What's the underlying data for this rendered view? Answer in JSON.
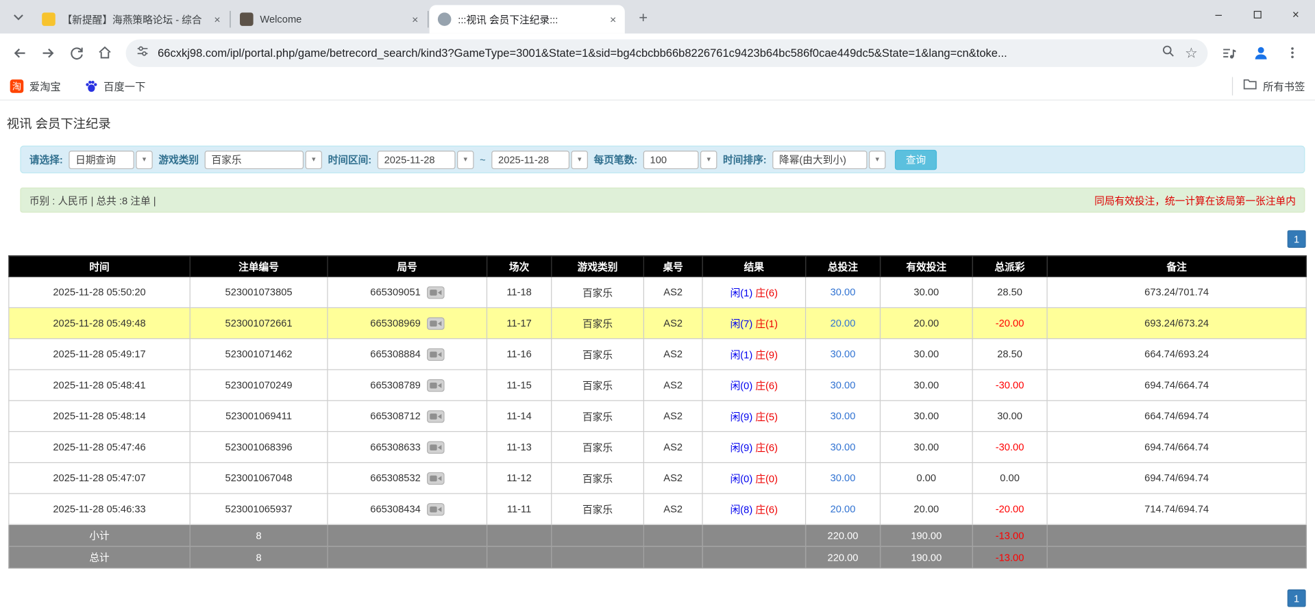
{
  "colors": {
    "accent-blue": "#337ab7",
    "link-blue": "#3173d2",
    "player-blue": "#0000ee",
    "banker-red": "#ee0000",
    "negative-red": "#ff0000",
    "notice-red": "#dd0000",
    "highlight-yellow": "#ffff99",
    "header-black": "#000000",
    "footer-gray": "#8a8a8a",
    "filter-bg": "#d9edf7",
    "filter-border": "#bce8f1",
    "filter-label": "#31708f",
    "summary-bg": "#dff0d8",
    "summary-border": "#d6e9c6",
    "search-btn": "#5bc0de"
  },
  "browser": {
    "tabs": [
      {
        "title": "【新提醒】海燕策略论坛 - 综合"
      },
      {
        "title": "Welcome"
      },
      {
        "title": ":::视讯 会员下注纪录:::"
      }
    ],
    "url": "66cxkj98.com/ipl/portal.php/game/betrecord_search/kind3?GameType=3001&State=1&sid=bg4cbcbb66b8226761c9423b64bc586f0cae449dc5&State=1&lang=cn&toke...",
    "bookmarks": [
      {
        "label": "爱淘宝"
      },
      {
        "label": "百度一下"
      }
    ],
    "all_bookmarks_label": "所有书签"
  },
  "page": {
    "title": "视讯 会员下注纪录",
    "filters": {
      "select_label": "请选择:",
      "select_value": "日期查询",
      "game_type_label": "游戏类别",
      "game_type_value": "百家乐",
      "date_range_label": "时间区间:",
      "date_from": "2025-11-28",
      "date_separator": "~",
      "date_to": "2025-11-28",
      "per_page_label": "每页笔数:",
      "per_page_value": "100",
      "sort_label": "时间排序:",
      "sort_value": "降幂(由大到小)",
      "search_button_label": "查询"
    },
    "summary_text": "币别 : 人民币 | 总共 :8 注单 |",
    "notice_text": "同局有效投注，统一计算在该局第一张注单内",
    "pagination_label": "1"
  },
  "table": {
    "headers": [
      "时间",
      "注单编号",
      "局号",
      "场次",
      "游戏类别",
      "桌号",
      "结果",
      "总投注",
      "有效投注",
      "总派彩",
      "备注"
    ],
    "rows": [
      {
        "time": "2025-11-28 05:50:20",
        "bet_id": "523001073805",
        "round_id": "665309051",
        "session": "11-18",
        "game": "百家乐",
        "table_no": "AS2",
        "result_player": "闲(1)",
        "result_banker": "庄(6)",
        "total_bet": "30.00",
        "valid_bet": "30.00",
        "payout": "28.50",
        "note": "673.24/701.74",
        "highlight": false
      },
      {
        "time": "2025-11-28 05:49:48",
        "bet_id": "523001072661",
        "round_id": "665308969",
        "session": "11-17",
        "game": "百家乐",
        "table_no": "AS2",
        "result_player": "闲(7)",
        "result_banker": "庄(1)",
        "total_bet": "20.00",
        "valid_bet": "20.00",
        "payout": "-20.00",
        "note": "693.24/673.24",
        "highlight": true
      },
      {
        "time": "2025-11-28 05:49:17",
        "bet_id": "523001071462",
        "round_id": "665308884",
        "session": "11-16",
        "game": "百家乐",
        "table_no": "AS2",
        "result_player": "闲(1)",
        "result_banker": "庄(9)",
        "total_bet": "30.00",
        "valid_bet": "30.00",
        "payout": "28.50",
        "note": "664.74/693.24",
        "highlight": false
      },
      {
        "time": "2025-11-28 05:48:41",
        "bet_id": "523001070249",
        "round_id": "665308789",
        "session": "11-15",
        "game": "百家乐",
        "table_no": "AS2",
        "result_player": "闲(0)",
        "result_banker": "庄(6)",
        "total_bet": "30.00",
        "valid_bet": "30.00",
        "payout": "-30.00",
        "note": "694.74/664.74",
        "highlight": false
      },
      {
        "time": "2025-11-28 05:48:14",
        "bet_id": "523001069411",
        "round_id": "665308712",
        "session": "11-14",
        "game": "百家乐",
        "table_no": "AS2",
        "result_player": "闲(9)",
        "result_banker": "庄(5)",
        "total_bet": "30.00",
        "valid_bet": "30.00",
        "payout": "30.00",
        "note": "664.74/694.74",
        "highlight": false
      },
      {
        "time": "2025-11-28 05:47:46",
        "bet_id": "523001068396",
        "round_id": "665308633",
        "session": "11-13",
        "game": "百家乐",
        "table_no": "AS2",
        "result_player": "闲(9)",
        "result_banker": "庄(6)",
        "total_bet": "30.00",
        "valid_bet": "30.00",
        "payout": "-30.00",
        "note": "694.74/664.74",
        "highlight": false
      },
      {
        "time": "2025-11-28 05:47:07",
        "bet_id": "523001067048",
        "round_id": "665308532",
        "session": "11-12",
        "game": "百家乐",
        "table_no": "AS2",
        "result_player": "闲(0)",
        "result_banker": "庄(0)",
        "total_bet": "30.00",
        "valid_bet": "0.00",
        "payout": "0.00",
        "note": "694.74/694.74",
        "highlight": false
      },
      {
        "time": "2025-11-28 05:46:33",
        "bet_id": "523001065937",
        "round_id": "665308434",
        "session": "11-11",
        "game": "百家乐",
        "table_no": "AS2",
        "result_player": "闲(8)",
        "result_banker": "庄(6)",
        "total_bet": "20.00",
        "valid_bet": "20.00",
        "payout": "-20.00",
        "note": "714.74/694.74",
        "highlight": false
      }
    ],
    "footer_rows": [
      {
        "label": "小计",
        "count": "8",
        "total_bet": "220.00",
        "valid_bet": "190.00",
        "payout": "-13.00"
      },
      {
        "label": "总计",
        "count": "8",
        "total_bet": "220.00",
        "valid_bet": "190.00",
        "payout": "-13.00"
      }
    ]
  }
}
